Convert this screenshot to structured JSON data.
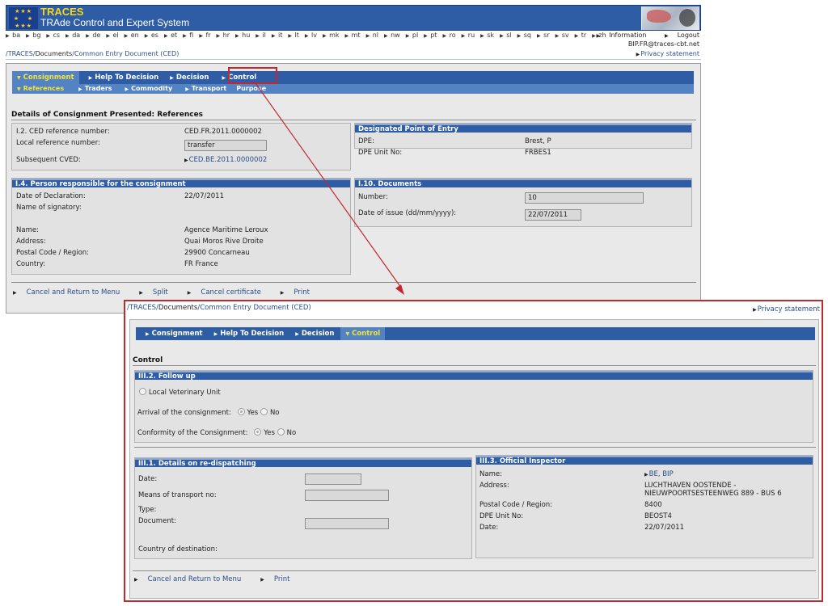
{
  "app": {
    "title": "TRACES",
    "subtitle": "TRAde Control and Expert System"
  },
  "languages": [
    "ba",
    "bg",
    "cs",
    "da",
    "de",
    "el",
    "en",
    "es",
    "et",
    "fi",
    "fr",
    "hr",
    "hu",
    "il",
    "it",
    "lt",
    "lv",
    "mk",
    "mt",
    "nl",
    "nw",
    "pl",
    "pt",
    "ro",
    "ru",
    "sk",
    "sl",
    "sq",
    "sr",
    "sv",
    "tr",
    "zh"
  ],
  "toplinks": {
    "information": "Information",
    "logout": "Logout"
  },
  "user_email": "BIP.FR@traces-cbt.net",
  "breadcrumb": {
    "root": "/TRACES/",
    "documents": "Documents",
    "current": "/Common Entry Document (CED)"
  },
  "privacy": "Privacy statement",
  "tabs": [
    "Consignment",
    "Help To Decision",
    "Decision",
    "Control"
  ],
  "subtabs": [
    "References",
    "Traders",
    "Commodity",
    "Transport",
    "Purpose"
  ],
  "window1": {
    "section_title": "Details of Consignment Presented: References",
    "ref": {
      "ced_label": "I.2. CED reference number:",
      "ced_value": "CED.FR.2011.0000002",
      "local_label": "Local reference number:",
      "local_value": "transfer",
      "subsequent_label": "Subsequent CVED:",
      "subsequent_value": "CED.BE.2011.0000002"
    },
    "dpe": {
      "title": "Designated Point of Entry",
      "dpe_label": "DPE:",
      "dpe_value": "Brest, P",
      "unit_label": "DPE Unit No:",
      "unit_value": "FRBES1"
    },
    "person": {
      "title": "I.4. Person responsible for the consignment",
      "date_label": "Date of Declaration:",
      "date_value": "22/07/2011",
      "signatory_label": "Name of signatory:",
      "name_label": "Name:",
      "name_value": "Agence Maritime Leroux",
      "address_label": "Address:",
      "address_value": "Quai Moros Rive Droite",
      "postal_label": "Postal Code / Region:",
      "postal_value": "29900 Concarneau",
      "country_label": "Country:",
      "country_value": "FR France"
    },
    "documents": {
      "title": "I.10. Documents",
      "number_label": "Number:",
      "number_value": "10",
      "date_label": "Date of issue (dd/mm/yyyy):",
      "date_value": "22/07/2011"
    },
    "actions": [
      "Cancel and Return to Menu",
      "Split",
      "Cancel certificate",
      "Print"
    ]
  },
  "window2": {
    "section_title": "Control",
    "followup": {
      "title": "III.2. Follow up",
      "local_vet": "Local Veterinary Unit",
      "arrival_label": "Arrival of the consignment:",
      "conformity_label": "Conformity of the Consignment:",
      "yes": "Yes",
      "no": "No"
    },
    "redispatch": {
      "title": "III.1. Details on re-dispatching",
      "date_label": "Date:",
      "transport_label": "Means of transport no:",
      "type_label": "Type:",
      "document_label": "Document:",
      "country_label": "Country of destination:"
    },
    "inspector": {
      "title": "III.3. Official Inspector",
      "name_label": "Name:",
      "name_value": "BE, BIP",
      "address_label": "Address:",
      "address_line1": "LUCHTHAVEN OOSTENDE -",
      "address_line2": "NIEUWPOORTSESTEENWEG 889 - BUS 6",
      "postal_label": "Postal Code / Region:",
      "postal_value": "8400",
      "unit_label": "DPE Unit No:",
      "unit_value": "BEOST4",
      "date_label": "Date:",
      "date_value": "22/07/2011"
    },
    "actions": [
      "Cancel and Return to Menu",
      "Print"
    ]
  },
  "colors": {
    "nav": "#2e5da6",
    "subnav": "#5483c4",
    "active_tab_text": "#f3e23a",
    "callout": "#c2292e"
  }
}
